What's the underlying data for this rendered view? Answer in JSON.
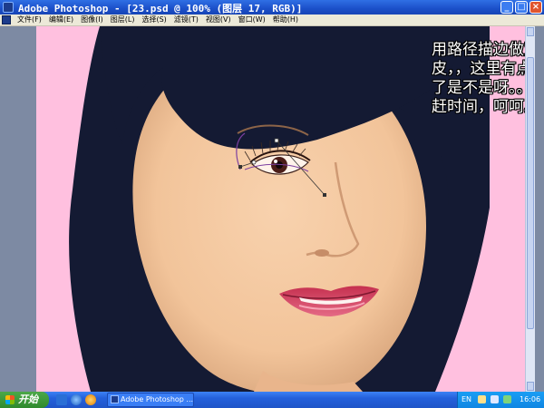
{
  "window": {
    "title": "Adobe Photoshop - [23.psd @ 100% (图层 17, RGB)]",
    "buttons": {
      "minimize": "_",
      "maximize": "□",
      "close": "×"
    }
  },
  "menu": {
    "items": [
      "文件(F)",
      "编辑(E)",
      "图像(I)",
      "图层(L)",
      "选择(S)",
      "滤镜(T)",
      "视图(V)",
      "窗口(W)",
      "帮助(H)"
    ]
  },
  "canvas": {
    "annotation": "用路径描边做双眼皮，，这里有点马虎了是不是呀。。我在赶时间，呵呵。。"
  },
  "taskbar": {
    "start_label": "开始",
    "task_label": "Adobe Photoshop ...",
    "tray": {
      "lang": "EN",
      "time": "16:06"
    }
  },
  "colors": {
    "canvas_bg": "#ffc0df",
    "hair": "#141a33",
    "skin": "#f6c9a0",
    "lips": "#d23d5c",
    "path": "#6b2d8a",
    "titlebar": "#1b4fc9",
    "taskbar": "#2460db"
  },
  "icons": [
    "photoshop-icon",
    "minimize-icon",
    "maximize-icon",
    "close-icon",
    "windows-flag-icon",
    "ie-icon",
    "media-icon",
    "speaker-icon",
    "network-icon"
  ]
}
